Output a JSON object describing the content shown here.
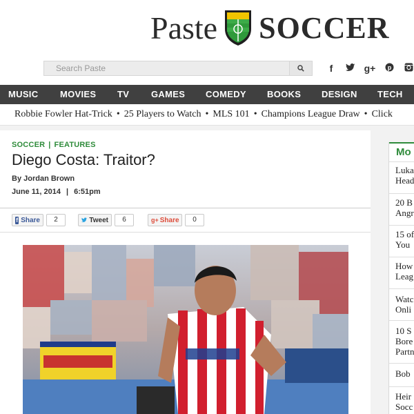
{
  "brand": {
    "paste": "Paste",
    "soccer": "SOCCER"
  },
  "search": {
    "placeholder": "Search Paste"
  },
  "social": [
    "facebook-icon",
    "twitter-icon",
    "google-plus-icon",
    "pinterest-icon",
    "instagram-icon"
  ],
  "social_glyphs": [
    "f",
    "t",
    "g+",
    "p",
    "ig"
  ],
  "nav": [
    "MUSIC",
    "MOVIES",
    "TV",
    "GAMES",
    "COMEDY",
    "BOOKS",
    "DESIGN",
    "TECH"
  ],
  "ticker": [
    "Robbie Fowler Hat-Trick",
    "25 Players to Watch",
    "MLS 101",
    "Champions League Draw",
    "Click"
  ],
  "ticker_sep": "•",
  "article": {
    "category1": "SOCCER",
    "pipe": "|",
    "category2": "FEATURES",
    "title": "Diego Costa: Traitor?",
    "byline": "By Jordan Brown",
    "date": "June 11, 2014",
    "date_sep": "|",
    "time": "6:51pm"
  },
  "share": {
    "facebook_label": "Share",
    "facebook_count": "2",
    "twitter_label": "Tweet",
    "twitter_count": "6",
    "gplus_label": "Share",
    "gplus_count": "0"
  },
  "sidebar": {
    "heading": "Mo",
    "items": [
      [
        "Luka",
        "Head"
      ],
      [
        "20 B",
        "Angr"
      ],
      [
        "15 of",
        "You"
      ],
      [
        "How",
        "Leag"
      ],
      [
        "Watc",
        "Onli"
      ],
      [
        "10 S",
        "Bore",
        "Partn"
      ],
      [
        "Bob"
      ],
      [
        "Heir",
        "Socc"
      ]
    ]
  },
  "colors": {
    "accent": "#2e8b3a",
    "nav_bg": "#404040",
    "facebook": "#3b5998"
  }
}
